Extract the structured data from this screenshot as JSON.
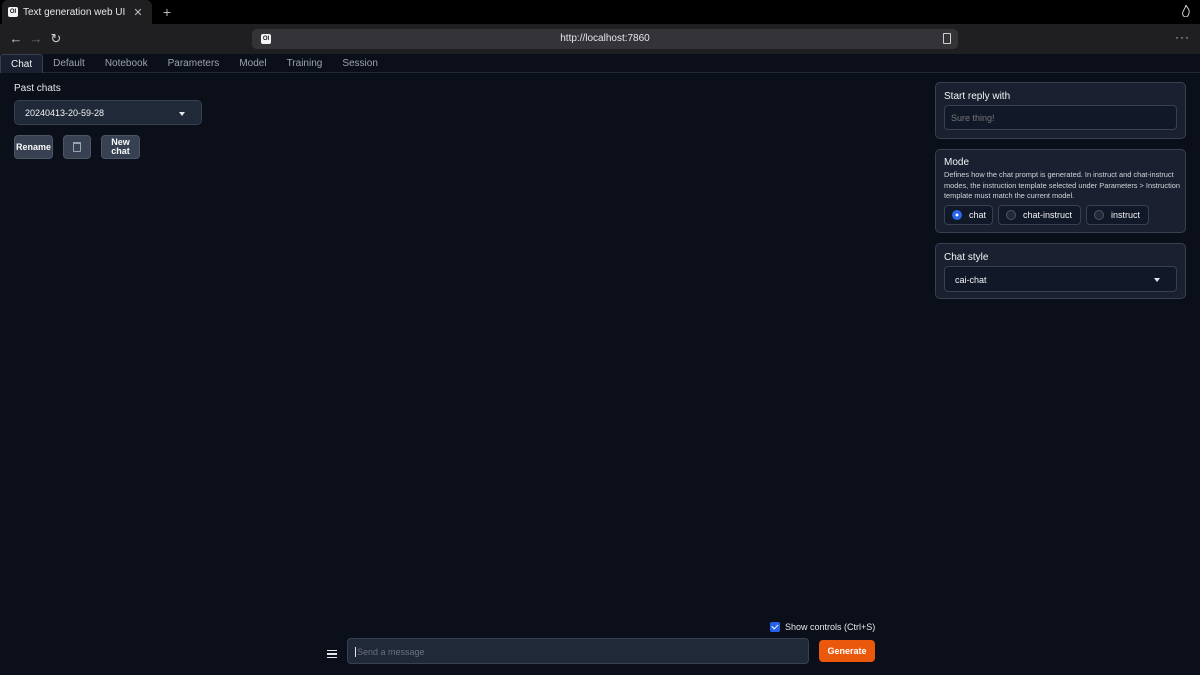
{
  "browser": {
    "tab_title": "Text generation web UI",
    "favicon_text": "OI",
    "url": "http://localhost:7860",
    "close_glyph": "✕",
    "new_tab_glyph": "+",
    "back_glyph": "←",
    "forward_glyph": "→",
    "reload_glyph": "↻",
    "menu_glyph": "···"
  },
  "app_tabs": [
    "Chat",
    "Default",
    "Notebook",
    "Parameters",
    "Model",
    "Training",
    "Session"
  ],
  "active_tab": "Chat",
  "left": {
    "past_chats_label": "Past chats",
    "selected_chat": "20240413-20-59-28",
    "rename_label": "Rename",
    "new_chat_label_line1": "New",
    "new_chat_label_line2": "chat"
  },
  "right": {
    "start_reply": {
      "title": "Start reply with",
      "placeholder": "Sure thing!"
    },
    "mode": {
      "title": "Mode",
      "description": "Defines how the chat prompt is generated. In instruct and chat-instruct modes, the instruction template selected under Parameters > Instruction template must match the current model.",
      "options": [
        "chat",
        "chat-instruct",
        "instruct"
      ],
      "selected": "chat"
    },
    "chat_style": {
      "title": "Chat style",
      "value": "cai-chat"
    }
  },
  "bottom": {
    "show_controls_label": "Show controls (Ctrl+S)",
    "show_controls_checked": true,
    "message_placeholder": "Send a message",
    "generate_label": "Generate"
  },
  "colors": {
    "background": "#0b0f19",
    "accent": "#ea580c",
    "selected": "#2563eb"
  }
}
